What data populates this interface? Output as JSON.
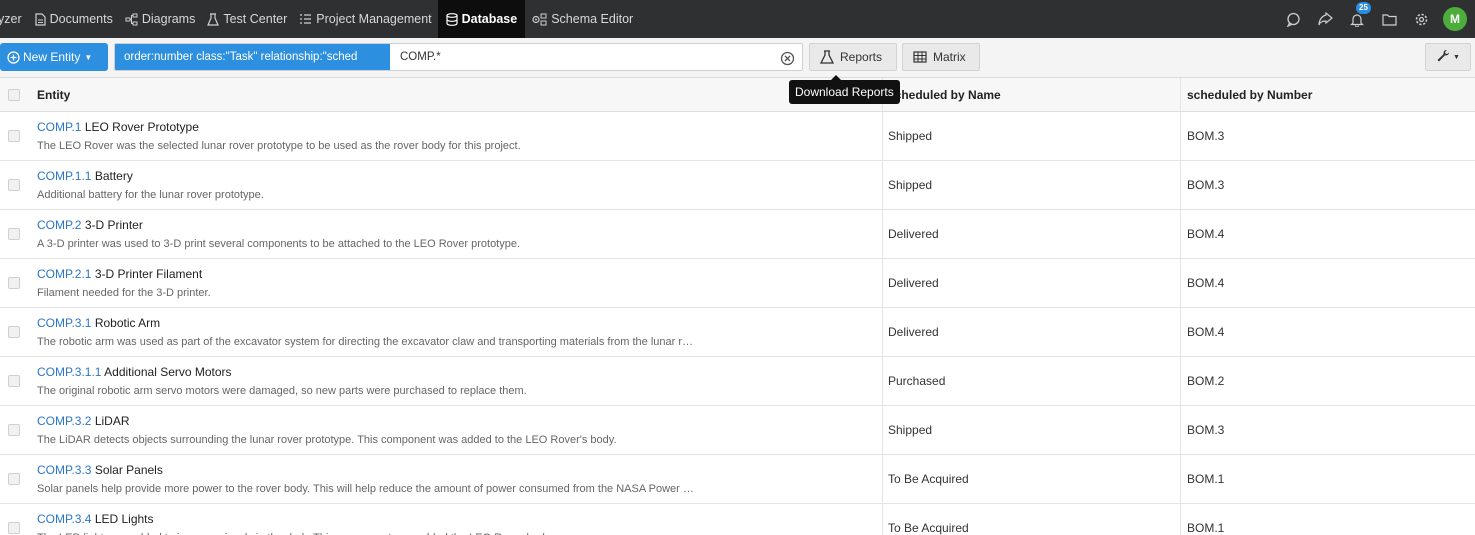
{
  "nav": {
    "tabs": [
      {
        "label": "yzer",
        "icon": ""
      },
      {
        "label": "Documents",
        "icon": "document-icon"
      },
      {
        "label": "Diagrams",
        "icon": "diagram-icon"
      },
      {
        "label": "Test Center",
        "icon": "flask-icon"
      },
      {
        "label": "Project Management",
        "icon": "list-icon"
      },
      {
        "label": "Database",
        "icon": "database-icon"
      },
      {
        "label": "Schema Editor",
        "icon": "schema-icon"
      }
    ],
    "active_tab": "Database",
    "notification_count": "25",
    "avatar_initial": "M"
  },
  "toolbar": {
    "new_entity_label": "New Entity",
    "search_selected": "order:number class:\"Task\" relationship:\"sched",
    "search_text": "COMP.*",
    "reports_label": "Reports",
    "matrix_label": "Matrix"
  },
  "tooltip": "Download Reports",
  "table": {
    "headers": {
      "entity": "Entity",
      "name": "scheduled by Name",
      "number": "scheduled by Number"
    },
    "rows": [
      {
        "id": "COMP.1",
        "title": "LEO Rover Prototype",
        "desc": "The LEO Rover was the selected lunar rover prototype to be used as the rover body for this project.",
        "name": "Shipped",
        "number": "BOM.3"
      },
      {
        "id": "COMP.1.1",
        "title": "Battery",
        "desc": "Additional battery for the lunar rover prototype.",
        "name": "Shipped",
        "number": "BOM.3"
      },
      {
        "id": "COMP.2",
        "title": "3-D Printer",
        "desc": "A 3-D printer was used to 3-D print several components to be attached to the LEO Rover prototype.",
        "name": "Delivered",
        "number": "BOM.4"
      },
      {
        "id": "COMP.2.1",
        "title": "3-D Printer Filament",
        "desc": "Filament needed for the 3-D printer.",
        "name": "Delivered",
        "number": "BOM.4"
      },
      {
        "id": "COMP.3.1",
        "title": "Robotic Arm",
        "desc": "The robotic arm was used as part of the excavator system for directing the excavator claw and transporting materials from the lunar r…",
        "name": "Delivered",
        "number": "BOM.4"
      },
      {
        "id": "COMP.3.1.1",
        "title": "Additional Servo Motors",
        "desc": "The original robotic arm servo motors were damaged, so new parts were purchased to replace them.",
        "name": "Purchased",
        "number": "BOM.2"
      },
      {
        "id": "COMP.3.2",
        "title": "LiDAR",
        "desc": "The LiDAR detects objects surrounding the lunar rover prototype. This component was added to the LEO Rover's body.",
        "name": "Shipped",
        "number": "BOM.3"
      },
      {
        "id": "COMP.3.3",
        "title": "Solar Panels",
        "desc": "Solar panels help provide more power to the rover body. This will help reduce the amount of power consumed from the NASA Power …",
        "name": "To Be Acquired",
        "number": "BOM.1"
      },
      {
        "id": "COMP.3.4",
        "title": "LED Lights",
        "desc": "The LED lights are added to improve visuals in the dark. This component was added the LEO Rover body.",
        "name": "To Be Acquired",
        "number": "BOM.1"
      }
    ]
  },
  "colors": {
    "accent": "#2d8fe0",
    "nav_bg": "#2f3031",
    "link": "#2a76c8",
    "avatar": "#4cae3a"
  }
}
